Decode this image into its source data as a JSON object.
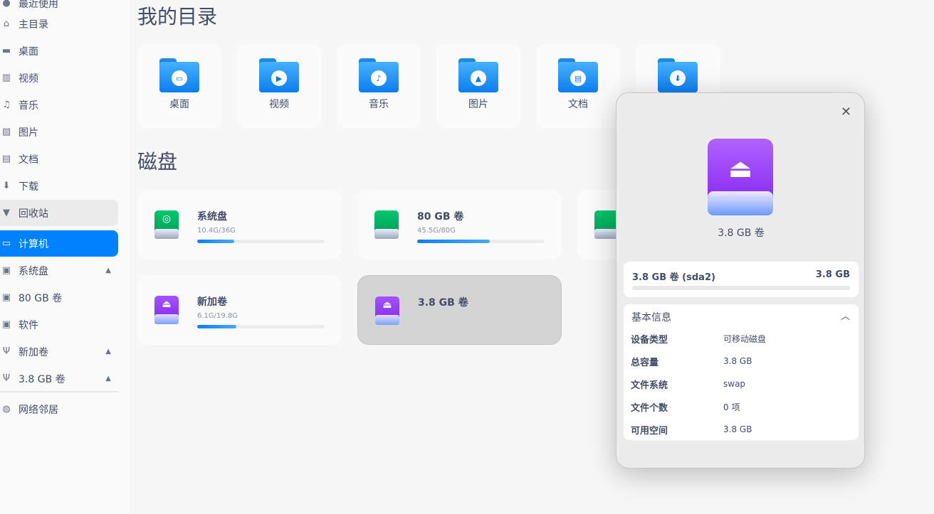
{
  "sidebar": {
    "items": [
      {
        "label": "最近使用",
        "icon": "clock-icon"
      },
      {
        "label": "主目录",
        "icon": "home-icon"
      },
      {
        "label": "桌面",
        "icon": "desktop-icon"
      },
      {
        "label": "视频",
        "icon": "film-icon"
      },
      {
        "label": "音乐",
        "icon": "music-icon"
      },
      {
        "label": "图片",
        "icon": "image-icon"
      },
      {
        "label": "文档",
        "icon": "document-icon"
      },
      {
        "label": "下载",
        "icon": "download-icon"
      },
      {
        "label": "回收站",
        "icon": "trash-icon"
      },
      {
        "label": "计算机",
        "icon": "computer-icon"
      },
      {
        "label": "系统盘",
        "icon": "disk-icon"
      },
      {
        "label": "80 GB 卷",
        "icon": "disk-icon"
      },
      {
        "label": "软件",
        "icon": "disk-icon"
      },
      {
        "label": "新加卷",
        "icon": "usb-icon"
      },
      {
        "label": "3.8 GB 卷",
        "icon": "usb-icon"
      },
      {
        "label": "网络邻居",
        "icon": "network-icon"
      }
    ]
  },
  "main": {
    "my_dirs_title": "我的目录",
    "folders": [
      {
        "label": "桌面"
      },
      {
        "label": "视频"
      },
      {
        "label": "音乐"
      },
      {
        "label": "图片"
      },
      {
        "label": "文档"
      },
      {
        "label": ""
      }
    ],
    "disks_title": "磁盘",
    "disks": [
      {
        "name": "系统盘",
        "size": "10.4G/36G",
        "usage": 0.29
      },
      {
        "name": "80 GB 卷",
        "size": "45.5G/80G",
        "usage": 0.57
      },
      {
        "name": "新加卷",
        "size": "6.1G/19.8G",
        "usage": 0.31
      },
      {
        "name": "3.8 GB 卷",
        "size": ""
      }
    ]
  },
  "popup": {
    "title": "3.8 GB 卷",
    "partition_name": "3.8 GB 卷 (sda2)",
    "partition_size": "3.8 GB",
    "section": "基本信息",
    "rows": [
      {
        "k": "设备类型",
        "v": "可移动磁盘"
      },
      {
        "k": "总容量",
        "v": "3.8 GB"
      },
      {
        "k": "文件系统",
        "v": "swap"
      },
      {
        "k": "文件个数",
        "v": "0 项"
      },
      {
        "k": "可用空间",
        "v": "3.8 GB"
      }
    ]
  }
}
